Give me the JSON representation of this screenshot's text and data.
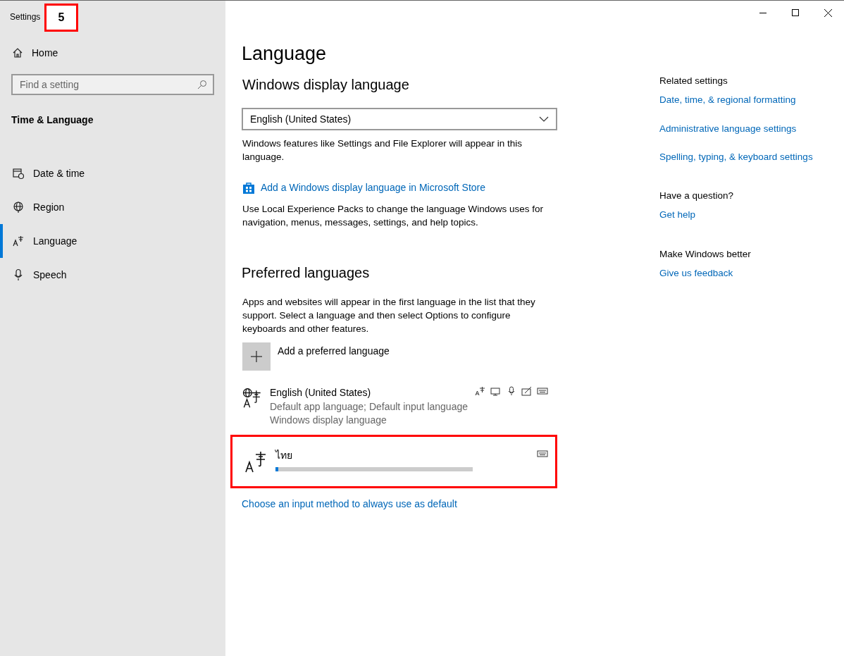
{
  "window": {
    "title": "Settings"
  },
  "annotation": {
    "label": "5"
  },
  "sidebar": {
    "home": "Home",
    "search": {
      "placeholder": "Find a setting"
    },
    "section": "Time & Language",
    "items": [
      {
        "label": "Date & time",
        "kind": "calendar",
        "selected": false
      },
      {
        "label": "Region",
        "kind": "globe",
        "selected": false
      },
      {
        "label": "Language",
        "kind": "language",
        "selected": true
      },
      {
        "label": "Speech",
        "kind": "microphone",
        "selected": false
      }
    ]
  },
  "main": {
    "title": "Language",
    "display_heading": "Windows display language",
    "display_value": "English (United States)",
    "display_note": "Windows features like Settings and File Explorer will appear in this language.",
    "store_link": "Add a Windows display language in Microsoft Store",
    "store_note": "Use Local Experience Packs to change the language Windows uses for navigation, menus, messages, settings, and help topics.",
    "preferred_heading": "Preferred languages",
    "preferred_note": "Apps and websites will appear in the first language in the list that they support. Select a language and then select Options to configure keyboards and other features.",
    "add_label": "Add a preferred language",
    "languages": [
      {
        "name": "English (United States)",
        "lines": [
          "Default app language; Default input language",
          "Windows display language"
        ],
        "kind": "installed",
        "highlighted": false,
        "features": [
          {
            "kind": "language"
          },
          {
            "kind": "display"
          },
          {
            "kind": "microphone"
          },
          {
            "kind": "handwriting"
          },
          {
            "kind": "keyboard"
          }
        ]
      },
      {
        "name": "ไทย",
        "kind": "installing",
        "level": 0.015,
        "highlighted": true,
        "features": [
          {
            "kind": "keyboard"
          }
        ]
      }
    ],
    "input_link": "Choose an input method to always use as default"
  },
  "related": [
    {
      "heading": "Related settings",
      "links": [
        "Date, time, & regional formatting",
        "Administrative language settings",
        "Spelling, typing, & keyboard settings"
      ]
    },
    {
      "heading": "Have a question?",
      "links": [
        "Get help"
      ]
    },
    {
      "heading": "Make Windows better",
      "links": [
        "Give us feedback"
      ]
    }
  ]
}
